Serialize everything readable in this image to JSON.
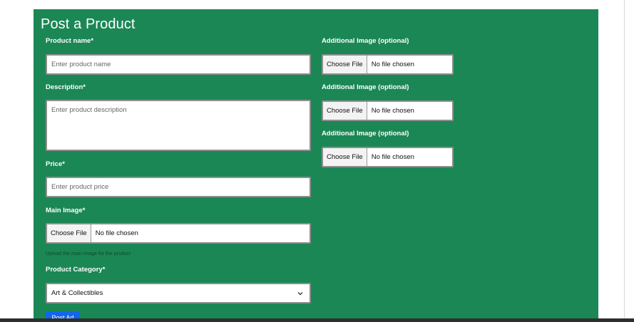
{
  "page": {
    "title": "Post a Product"
  },
  "fields": {
    "product_name": {
      "label": "Product name*",
      "placeholder": "Enter product name"
    },
    "description": {
      "label": "Description*",
      "placeholder": "Enter product description"
    },
    "price": {
      "label": "Price*",
      "placeholder": "Enter product price"
    },
    "main_image": {
      "label": "Main Image*",
      "button_label": "Choose File",
      "status": "No file chosen",
      "help": "Upload the main image for the product"
    },
    "category": {
      "label": "Product Category*",
      "selected": "Art & Collectibles"
    }
  },
  "additional_images": [
    {
      "label": "Additional Image (optional)",
      "button_label": "Choose File",
      "status": "No file chosen"
    },
    {
      "label": "Additional Image (optional)",
      "button_label": "Choose File",
      "status": "No file chosen"
    },
    {
      "label": "Additional Image (optional)",
      "button_label": "Choose File",
      "status": "No file chosen"
    }
  ],
  "actions": {
    "submit_label": "Post Ad"
  },
  "colors": {
    "card_background": "#1b8755",
    "submit_button": "#1166ee",
    "input_border": "#8e8e8e"
  },
  "icons": {
    "category_dropdown": "chevron-down-icon"
  }
}
